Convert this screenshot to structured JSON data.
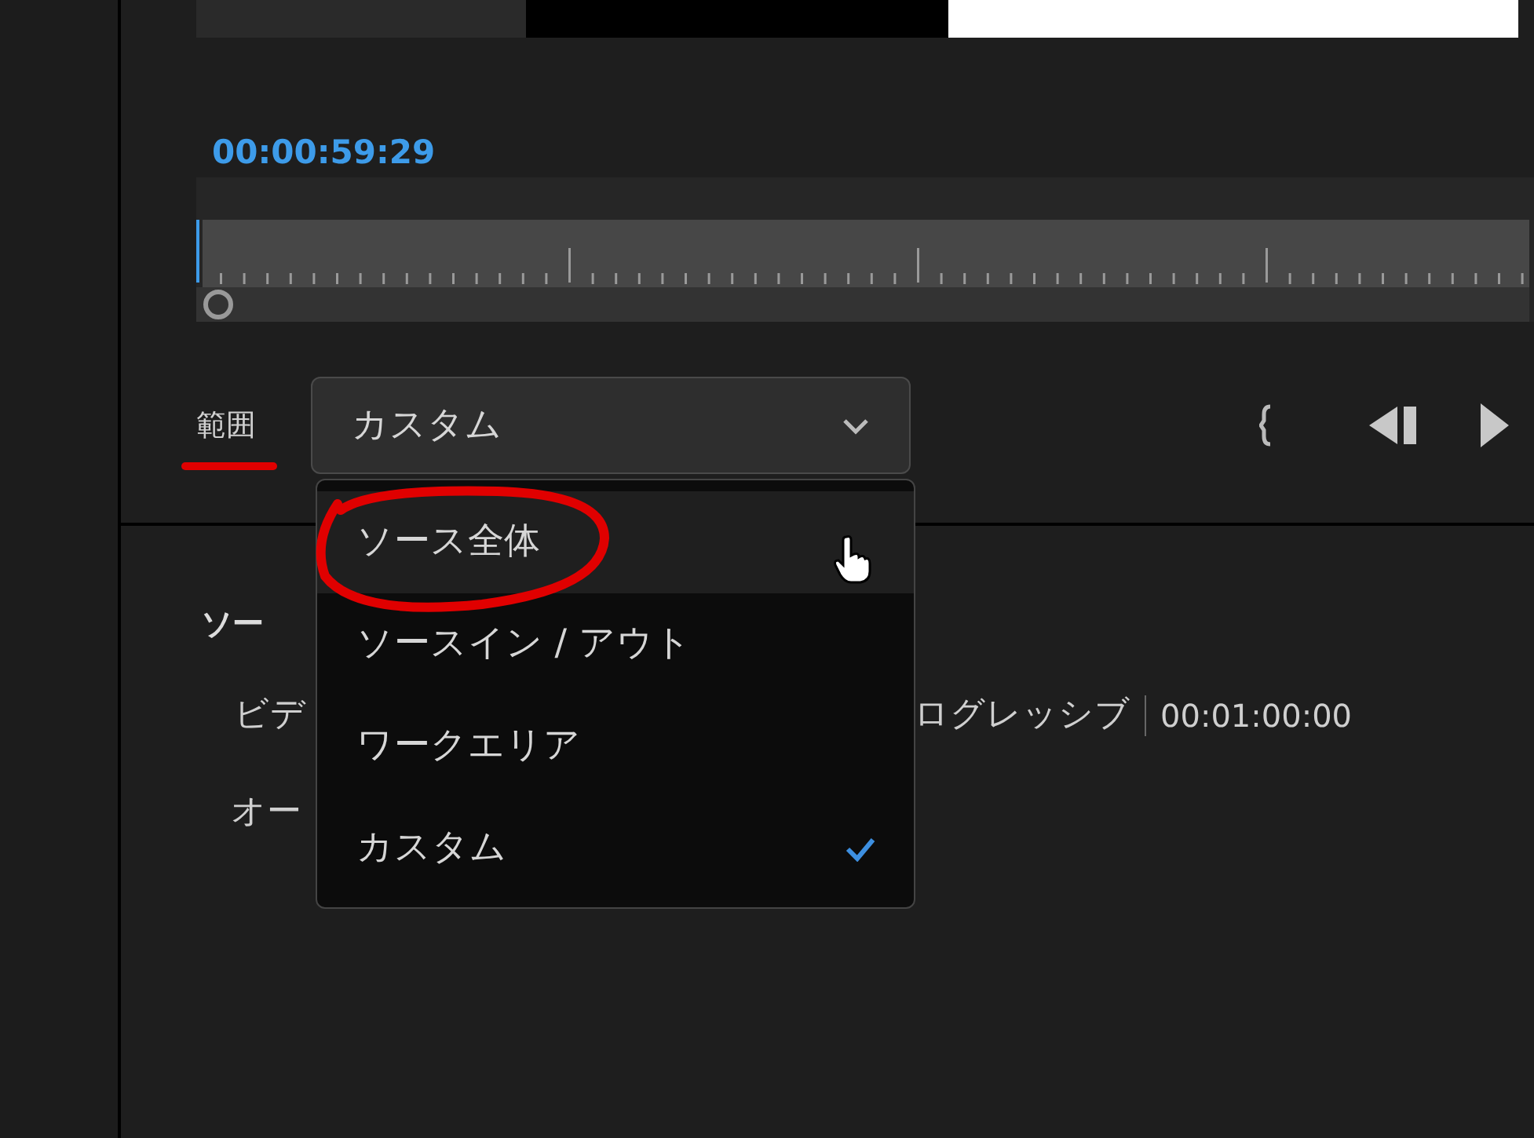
{
  "timecode": "00:00:59:29",
  "range": {
    "label": "範囲",
    "value": "カスタム"
  },
  "menu": [
    {
      "label": "ソース全体",
      "hovered": true,
      "checked": false
    },
    {
      "label": "ソースイン / アウト",
      "hovered": false,
      "checked": false
    },
    {
      "label": "ワークエリア",
      "hovered": false,
      "checked": false
    },
    {
      "label": "カスタム",
      "hovered": false,
      "checked": true
    }
  ],
  "source": {
    "heading": "ソー",
    "video_label": "ビデ",
    "video_value": "ログレッシブ",
    "video_duration": "00:01:00:00",
    "audio_label": "オー"
  }
}
